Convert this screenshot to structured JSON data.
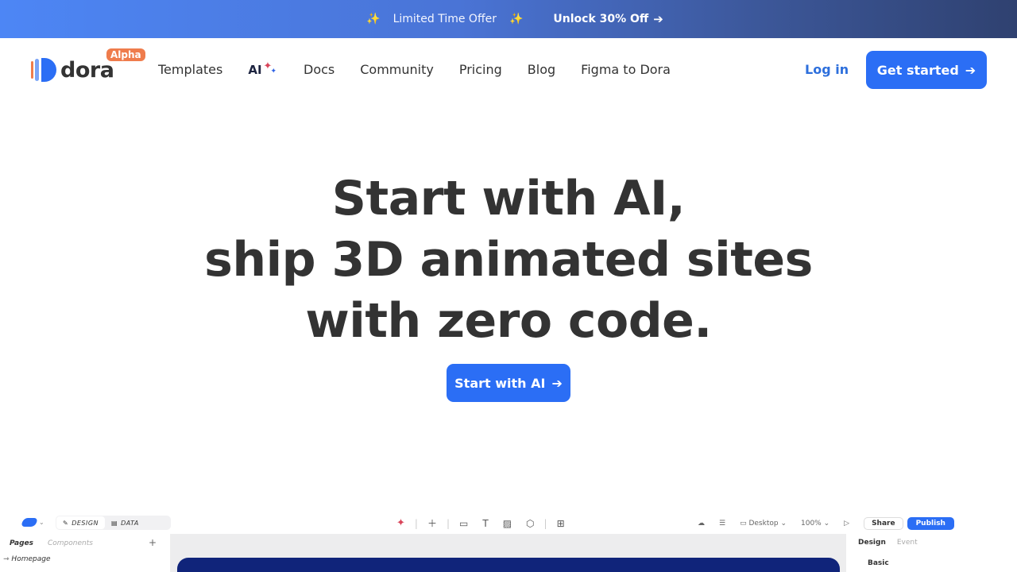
{
  "promo": {
    "sparkle_icon": "sparkles",
    "text": "Limited Time Offer",
    "cta": "Unlock 30% Off"
  },
  "brand": {
    "name": "dora",
    "badge": "Alpha",
    "accent": "#2b6ef5",
    "badge_color": "#ef7c4c"
  },
  "nav": {
    "items": [
      "Templates",
      "AI",
      "Docs",
      "Community",
      "Pricing",
      "Blog",
      "Figma to Dora"
    ],
    "login": "Log in",
    "get_started": "Get started"
  },
  "hero": {
    "line1": "Start with AI,",
    "line2": "ship 3D animated sites",
    "line3": "with zero code.",
    "cta": "Start with AI"
  },
  "editor": {
    "modes": [
      "DESIGN",
      "DATA"
    ],
    "right": {
      "device": "Desktop",
      "zoom": "100%",
      "share": "Share",
      "publish": "Publish"
    },
    "left_panel": {
      "tabs": [
        "Pages",
        "Components"
      ],
      "page": "Homepage"
    },
    "right_panel": {
      "tabs": [
        "Design",
        "Event"
      ],
      "section": "Basic"
    }
  }
}
